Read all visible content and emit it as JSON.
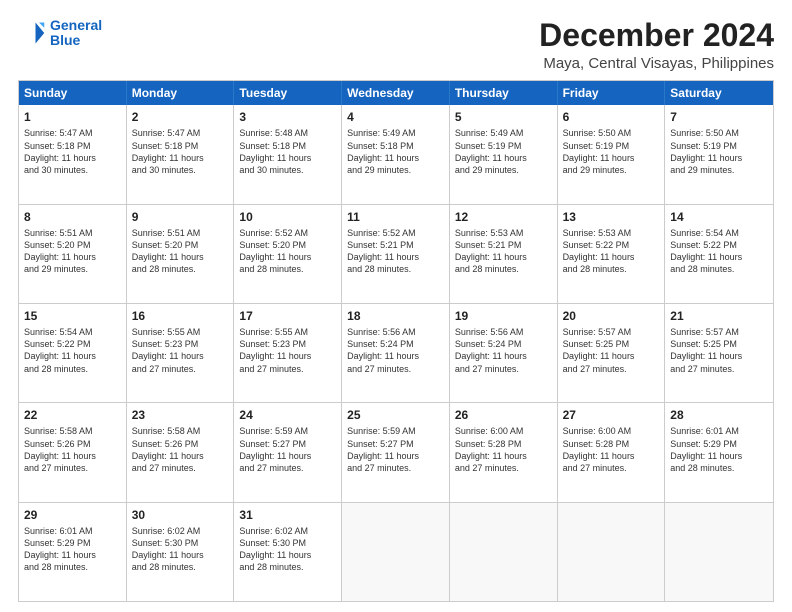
{
  "header": {
    "logo_line1": "General",
    "logo_line2": "Blue",
    "title": "December 2024",
    "subtitle": "Maya, Central Visayas, Philippines"
  },
  "calendar": {
    "days_of_week": [
      "Sunday",
      "Monday",
      "Tuesday",
      "Wednesday",
      "Thursday",
      "Friday",
      "Saturday"
    ],
    "weeks": [
      [
        {
          "day": "1",
          "text": "Sunrise: 5:47 AM\nSunset: 5:18 PM\nDaylight: 11 hours\nand 30 minutes."
        },
        {
          "day": "2",
          "text": "Sunrise: 5:47 AM\nSunset: 5:18 PM\nDaylight: 11 hours\nand 30 minutes."
        },
        {
          "day": "3",
          "text": "Sunrise: 5:48 AM\nSunset: 5:18 PM\nDaylight: 11 hours\nand 30 minutes."
        },
        {
          "day": "4",
          "text": "Sunrise: 5:49 AM\nSunset: 5:18 PM\nDaylight: 11 hours\nand 29 minutes."
        },
        {
          "day": "5",
          "text": "Sunrise: 5:49 AM\nSunset: 5:19 PM\nDaylight: 11 hours\nand 29 minutes."
        },
        {
          "day": "6",
          "text": "Sunrise: 5:50 AM\nSunset: 5:19 PM\nDaylight: 11 hours\nand 29 minutes."
        },
        {
          "day": "7",
          "text": "Sunrise: 5:50 AM\nSunset: 5:19 PM\nDaylight: 11 hours\nand 29 minutes."
        }
      ],
      [
        {
          "day": "8",
          "text": "Sunrise: 5:51 AM\nSunset: 5:20 PM\nDaylight: 11 hours\nand 29 minutes."
        },
        {
          "day": "9",
          "text": "Sunrise: 5:51 AM\nSunset: 5:20 PM\nDaylight: 11 hours\nand 28 minutes."
        },
        {
          "day": "10",
          "text": "Sunrise: 5:52 AM\nSunset: 5:20 PM\nDaylight: 11 hours\nand 28 minutes."
        },
        {
          "day": "11",
          "text": "Sunrise: 5:52 AM\nSunset: 5:21 PM\nDaylight: 11 hours\nand 28 minutes."
        },
        {
          "day": "12",
          "text": "Sunrise: 5:53 AM\nSunset: 5:21 PM\nDaylight: 11 hours\nand 28 minutes."
        },
        {
          "day": "13",
          "text": "Sunrise: 5:53 AM\nSunset: 5:22 PM\nDaylight: 11 hours\nand 28 minutes."
        },
        {
          "day": "14",
          "text": "Sunrise: 5:54 AM\nSunset: 5:22 PM\nDaylight: 11 hours\nand 28 minutes."
        }
      ],
      [
        {
          "day": "15",
          "text": "Sunrise: 5:54 AM\nSunset: 5:22 PM\nDaylight: 11 hours\nand 28 minutes."
        },
        {
          "day": "16",
          "text": "Sunrise: 5:55 AM\nSunset: 5:23 PM\nDaylight: 11 hours\nand 27 minutes."
        },
        {
          "day": "17",
          "text": "Sunrise: 5:55 AM\nSunset: 5:23 PM\nDaylight: 11 hours\nand 27 minutes."
        },
        {
          "day": "18",
          "text": "Sunrise: 5:56 AM\nSunset: 5:24 PM\nDaylight: 11 hours\nand 27 minutes."
        },
        {
          "day": "19",
          "text": "Sunrise: 5:56 AM\nSunset: 5:24 PM\nDaylight: 11 hours\nand 27 minutes."
        },
        {
          "day": "20",
          "text": "Sunrise: 5:57 AM\nSunset: 5:25 PM\nDaylight: 11 hours\nand 27 minutes."
        },
        {
          "day": "21",
          "text": "Sunrise: 5:57 AM\nSunset: 5:25 PM\nDaylight: 11 hours\nand 27 minutes."
        }
      ],
      [
        {
          "day": "22",
          "text": "Sunrise: 5:58 AM\nSunset: 5:26 PM\nDaylight: 11 hours\nand 27 minutes."
        },
        {
          "day": "23",
          "text": "Sunrise: 5:58 AM\nSunset: 5:26 PM\nDaylight: 11 hours\nand 27 minutes."
        },
        {
          "day": "24",
          "text": "Sunrise: 5:59 AM\nSunset: 5:27 PM\nDaylight: 11 hours\nand 27 minutes."
        },
        {
          "day": "25",
          "text": "Sunrise: 5:59 AM\nSunset: 5:27 PM\nDaylight: 11 hours\nand 27 minutes."
        },
        {
          "day": "26",
          "text": "Sunrise: 6:00 AM\nSunset: 5:28 PM\nDaylight: 11 hours\nand 27 minutes."
        },
        {
          "day": "27",
          "text": "Sunrise: 6:00 AM\nSunset: 5:28 PM\nDaylight: 11 hours\nand 27 minutes."
        },
        {
          "day": "28",
          "text": "Sunrise: 6:01 AM\nSunset: 5:29 PM\nDaylight: 11 hours\nand 28 minutes."
        }
      ],
      [
        {
          "day": "29",
          "text": "Sunrise: 6:01 AM\nSunset: 5:29 PM\nDaylight: 11 hours\nand 28 minutes."
        },
        {
          "day": "30",
          "text": "Sunrise: 6:02 AM\nSunset: 5:30 PM\nDaylight: 11 hours\nand 28 minutes."
        },
        {
          "day": "31",
          "text": "Sunrise: 6:02 AM\nSunset: 5:30 PM\nDaylight: 11 hours\nand 28 minutes."
        },
        {
          "day": "",
          "text": ""
        },
        {
          "day": "",
          "text": ""
        },
        {
          "day": "",
          "text": ""
        },
        {
          "day": "",
          "text": ""
        }
      ]
    ]
  }
}
